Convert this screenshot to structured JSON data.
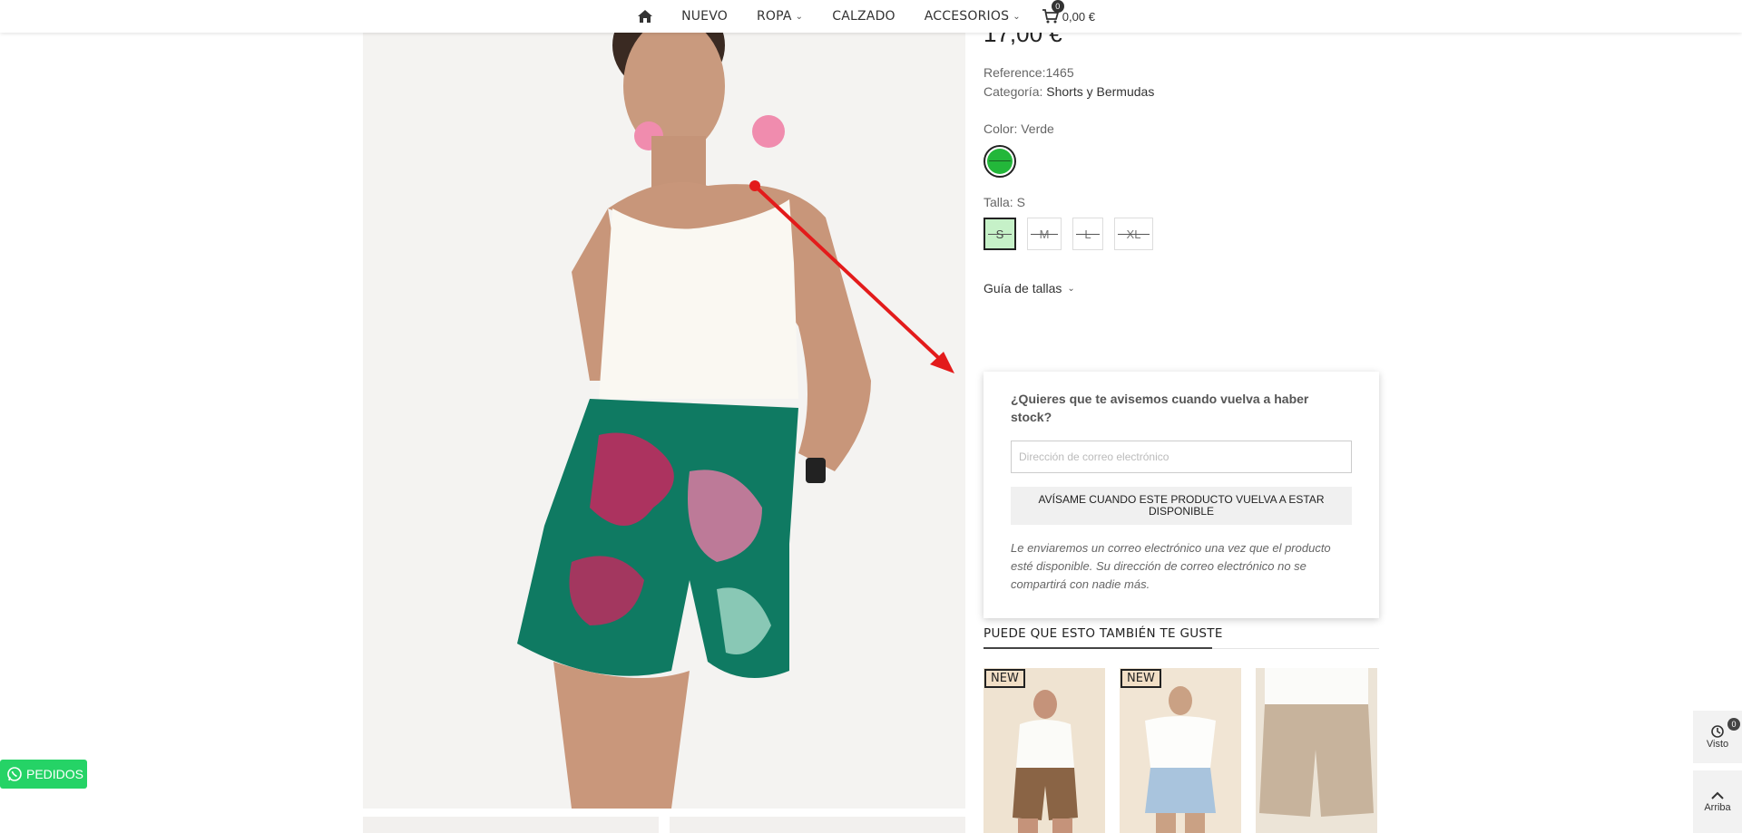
{
  "nav": {
    "items": [
      "NUEVO",
      "ROPA",
      "CALZADO",
      "ACCESORIOS"
    ],
    "cart_count": "0",
    "cart_total": "0,00 €"
  },
  "product": {
    "price": "17,00 €",
    "reference_label": "Reference:",
    "reference_value": "1465",
    "category_label": "Categoría:",
    "category_value": "Shorts y Bermudas",
    "color_label": "Color: Verde",
    "color_hex": "#23b73a",
    "size_label": "Talla: S",
    "sizes": [
      "S",
      "M",
      "L",
      "XL"
    ],
    "selected_size": "S",
    "size_guide": "Guía de tallas"
  },
  "notify": {
    "title": "¿Quieres que te avisemos cuando vuelva a haber stock?",
    "email_placeholder": "Dirección de correo electrónico",
    "button_label": "AVÍSAME CUANDO ESTE PRODUCTO VUELVA A ESTAR DISPONIBLE",
    "note": "Le enviaremos un correo electrónico una vez que el producto esté disponible. Su dirección de correo electrónico no se compartirá con nadie más."
  },
  "related": {
    "title": "PUEDE QUE ESTO TAMBIÉN TE GUSTE",
    "badge": "NEW"
  },
  "widgets": {
    "visto_label": "Visto",
    "visto_count": "0",
    "arriba_label": "Arriba",
    "pedidos_label": "PEDIDOS"
  }
}
